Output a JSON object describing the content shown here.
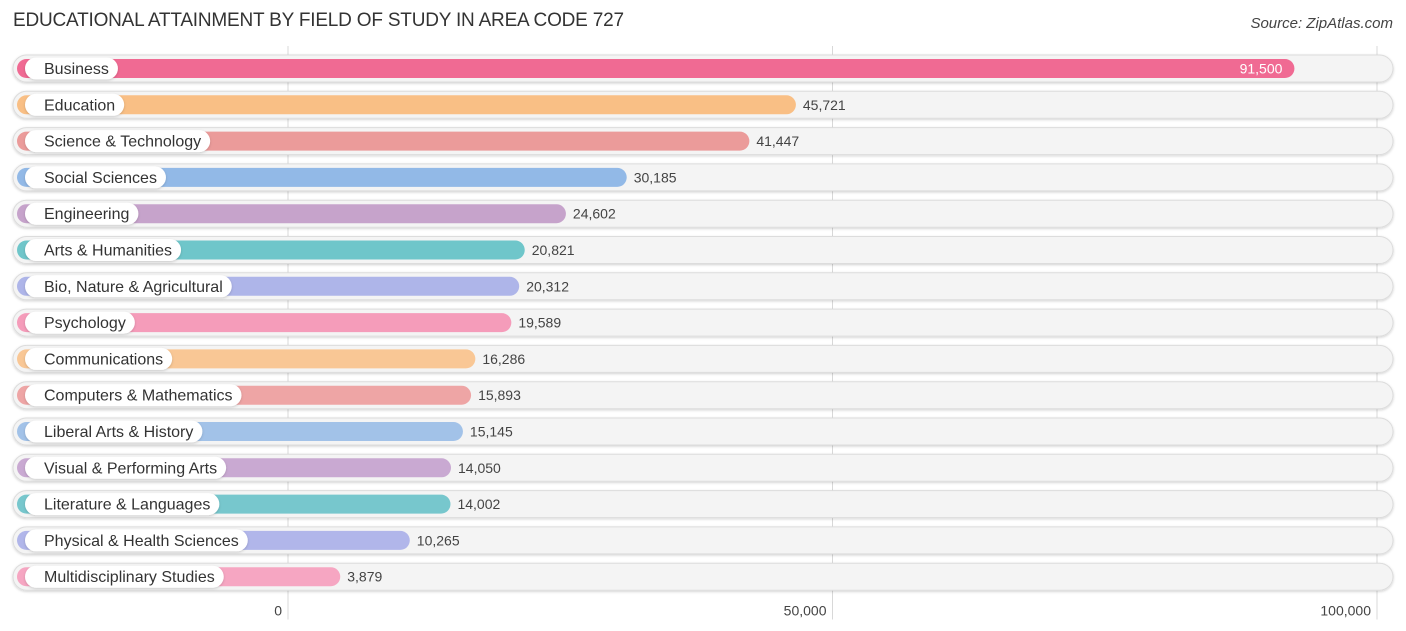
{
  "chart_data": {
    "type": "bar",
    "orientation": "horizontal",
    "title": "EDUCATIONAL ATTAINMENT BY FIELD OF STUDY IN AREA CODE 727",
    "source": "Source: ZipAtlas.com",
    "xlabel": "",
    "ylabel": "",
    "xlim": [
      0,
      100000
    ],
    "x_ticks": [
      0,
      50000,
      100000
    ],
    "x_tick_labels": [
      "0",
      "50,000",
      "100,000"
    ],
    "grid": true,
    "legend": "none",
    "categories": [
      "Business",
      "Education",
      "Science & Technology",
      "Social Sciences",
      "Engineering",
      "Arts & Humanities",
      "Bio, Nature & Agricultural",
      "Psychology",
      "Communications",
      "Computers & Mathematics",
      "Liberal Arts & History",
      "Visual & Performing Arts",
      "Literature & Languages",
      "Physical & Health Sciences",
      "Multidisciplinary Studies"
    ],
    "values": [
      91500,
      45721,
      41447,
      30185,
      24602,
      20821,
      20312,
      19589,
      16286,
      15893,
      15145,
      14050,
      14002,
      10265,
      3879
    ],
    "value_labels": [
      "91,500",
      "45,721",
      "41,447",
      "30,185",
      "24,602",
      "20,821",
      "20,312",
      "19,589",
      "16,286",
      "15,893",
      "15,145",
      "14,050",
      "14,002",
      "10,265",
      "3,879"
    ],
    "colors": [
      "#f06a93",
      "#f9bf85",
      "#eb9b9a",
      "#92b9e7",
      "#c6a3cb",
      "#6fc6ca",
      "#aeb5e9",
      "#f59cba",
      "#f9c795",
      "#eea5a5",
      "#a2c2e8",
      "#c9a9d2",
      "#77c7cd",
      "#b1b6ea",
      "#f6a6c2"
    ]
  }
}
